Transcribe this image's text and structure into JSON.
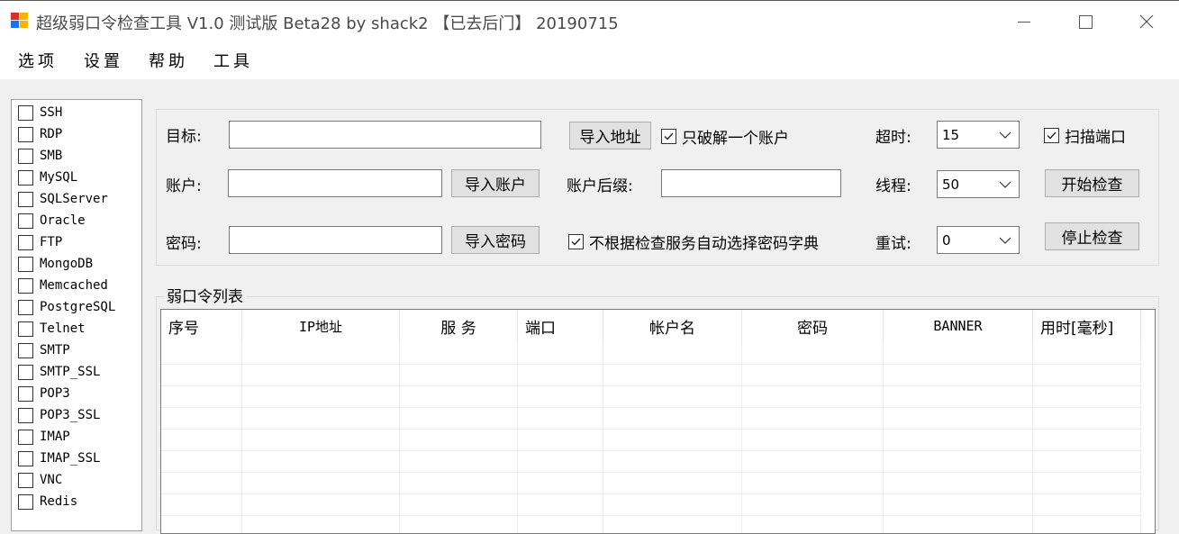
{
  "window": {
    "title": "超级弱口令检查工具 V1.0 测试版 Beta28 by shack2 【已去后门】 20190715"
  },
  "menu": [
    "选项",
    "设置",
    "帮助",
    "工具"
  ],
  "services": [
    "SSH",
    "RDP",
    "SMB",
    "MySQL",
    "SQLServer",
    "Oracle",
    "FTP",
    "MongoDB",
    "Memcached",
    "PostgreSQL",
    "Telnet",
    "SMTP",
    "SMTP_SSL",
    "POP3",
    "POP3_SSL",
    "IMAP",
    "IMAP_SSL",
    "VNC",
    "Redis"
  ],
  "form": {
    "target_label": "目标:",
    "account_label": "账户:",
    "password_label": "密码:",
    "import_address": "导入地址",
    "import_account": "导入账户",
    "import_password": "导入密码",
    "only_one_account": "只破解一个账户",
    "account_suffix_label": "账户后缀:",
    "auto_dict": "不根据检查服务自动选择密码字典",
    "timeout_label": "超时:",
    "timeout_value": "15",
    "threads_label": "线程:",
    "threads_value": "50",
    "retry_label": "重试:",
    "retry_value": "0",
    "scan_port": "扫描端口",
    "start_check": "开始检查",
    "stop_check": "停止检查"
  },
  "list": {
    "title": "弱口令列表",
    "columns": [
      "序号",
      "IP地址",
      "服 务",
      "端口",
      "帐户名",
      "密码",
      "BANNER",
      "用时[毫秒]"
    ]
  }
}
